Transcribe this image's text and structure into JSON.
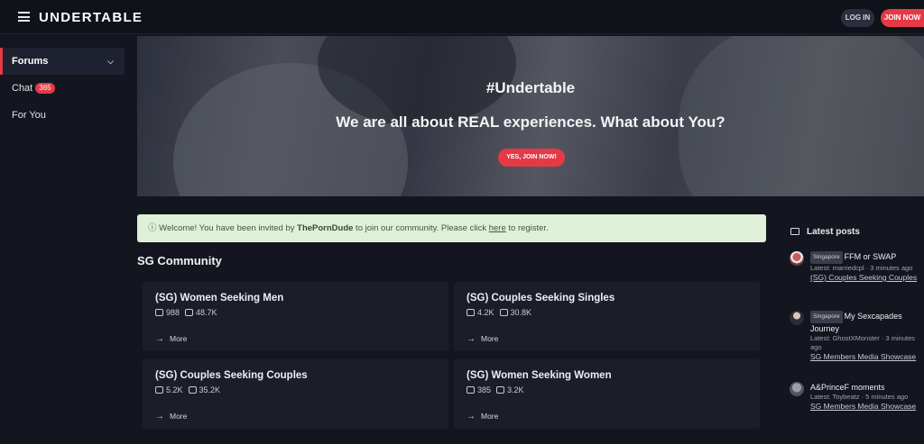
{
  "header": {
    "brand": "UNDERTABLE",
    "login_label": "LOG IN",
    "join_label": "JOIN NOW"
  },
  "sidebar": {
    "items": [
      {
        "label": "Forums",
        "active": true
      },
      {
        "label": "Chat",
        "badge": "365"
      },
      {
        "label": "For You"
      }
    ]
  },
  "hero": {
    "title": "#Undertable",
    "subtitle": "We are all about REAL experiences. What about You?",
    "cta": "YES, JOIN NOW!"
  },
  "notice": {
    "prefix": "Welcome! You have been invited by ",
    "inviter": "ThePornDude",
    "middle": " to join our community. Please click ",
    "link": "here",
    "suffix": " to register."
  },
  "community": {
    "title": "SG Community",
    "more_label": "More",
    "forums": [
      {
        "name": "(SG) Women Seeking Men",
        "threads": "988",
        "posts": "48.7K"
      },
      {
        "name": "(SG) Couples Seeking Singles",
        "threads": "4.2K",
        "posts": "30.8K"
      },
      {
        "name": "(SG) Couples Seeking Couples",
        "threads": "5.2K",
        "posts": "35.2K"
      },
      {
        "name": "(SG) Women Seeking Women",
        "threads": "385",
        "posts": "3.2K"
      }
    ]
  },
  "latest_posts": {
    "title": "Latest posts",
    "items": [
      {
        "tag": "Singapore",
        "title": "FFM or SWAP",
        "meta": "Latest: marriedcpl · 3 minutes ago",
        "forum": "(SG) Couples Seeking Couples"
      },
      {
        "tag": "Singapore",
        "title": "My Sexcapades Journey",
        "meta": "Latest: GhostXMonster · 3 minutes ago",
        "forum": "SG Members Media Showcase"
      },
      {
        "tag": "",
        "title": "A&PrinceF moments",
        "meta": "Latest: Toybeatz · 5 minutes ago",
        "forum": "SG Members Media Showcase"
      }
    ]
  },
  "colors": {
    "accent": "#e63946",
    "background": "#14161f",
    "card": "#1b1e29",
    "notice_bg": "#dff0d8"
  },
  "icons": {
    "menu": "hamburger-icon",
    "chevron": "chevron-down-icon",
    "threads": "speech-bubble-icon",
    "posts": "speech-bubbles-icon",
    "more": "arrow-right-icon",
    "info": "info-circle-icon"
  }
}
